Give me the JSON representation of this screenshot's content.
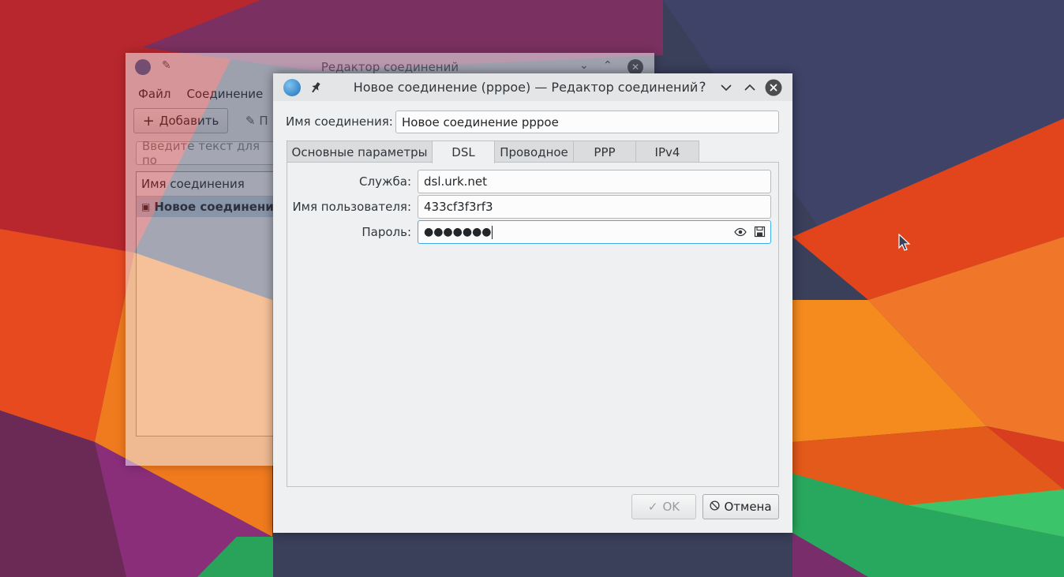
{
  "background_window": {
    "title": "Редактор соединений",
    "menu": [
      "Файл",
      "Соединение"
    ],
    "add_button": "Добавить",
    "next_button_partial": "П",
    "search_placeholder": "Введите текст для по",
    "list_header": "Имя соединения",
    "list_item": "Новое соединени"
  },
  "dialog": {
    "title": "Новое соединение (pppoe) — Редактор соединений",
    "help_label": "?",
    "connection_name_label": "Имя соединения:",
    "connection_name_value": "Новое соединение pppoe",
    "tabs": [
      {
        "label": "Основные параметры",
        "active": false
      },
      {
        "label": "DSL",
        "active": true
      },
      {
        "label": "Проводное",
        "active": false
      },
      {
        "label": "PPP",
        "active": false
      },
      {
        "label": "IPv4",
        "active": false
      }
    ],
    "fields": {
      "service_label": "Служба:",
      "service_value": "dsl.urk.net",
      "username_label": "Имя пользователя:",
      "username_value": "433cf3f3rf3",
      "password_label": "Пароль:",
      "password_mask": "●●●●●●●"
    },
    "ok_button": "OK",
    "cancel_button": "Отмена"
  },
  "colors": {
    "accent": "#3daee9",
    "window_bg": "#eff0f1",
    "close_button": "#4d4d4d"
  }
}
